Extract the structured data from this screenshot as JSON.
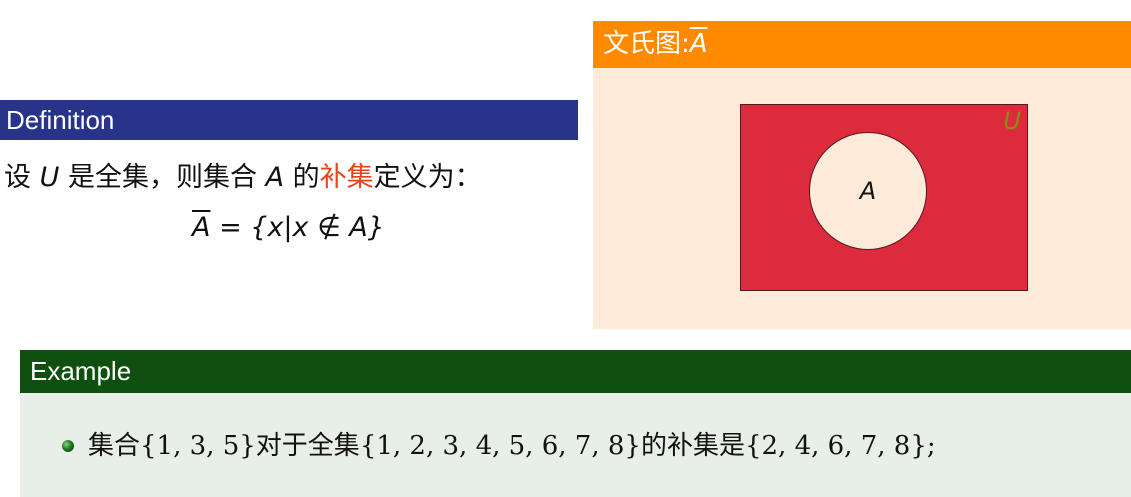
{
  "definition": {
    "header": "Definition",
    "text_prefix": "设 ",
    "var_u": "U",
    "text_mid1": " 是全集，则集合 ",
    "var_a": "A",
    "text_mid2": " 的",
    "highlight": "补集",
    "text_suffix": "定义为：",
    "formula_lhs": "A",
    "formula_rhs": " = {x|x ∉ A}"
  },
  "venn": {
    "title_text": "文氏图:",
    "title_symbol": "A",
    "universe_label": "U",
    "set_label": "A",
    "colors": {
      "header": "#ff8a00",
      "background": "#fdead8",
      "complement": "#dc2b3c",
      "universe_label": "#8a8d12"
    }
  },
  "example": {
    "header": "Example",
    "item": {
      "text1": "集合 ",
      "set1": "{1, 3, 5}",
      "text2": " 对于全集 ",
      "set2": "{1, 2, 3, 4, 5, 6, 7, 8}",
      "text3": " 的补集是 ",
      "set3": "{2, 4, 6, 7, 8};"
    }
  }
}
